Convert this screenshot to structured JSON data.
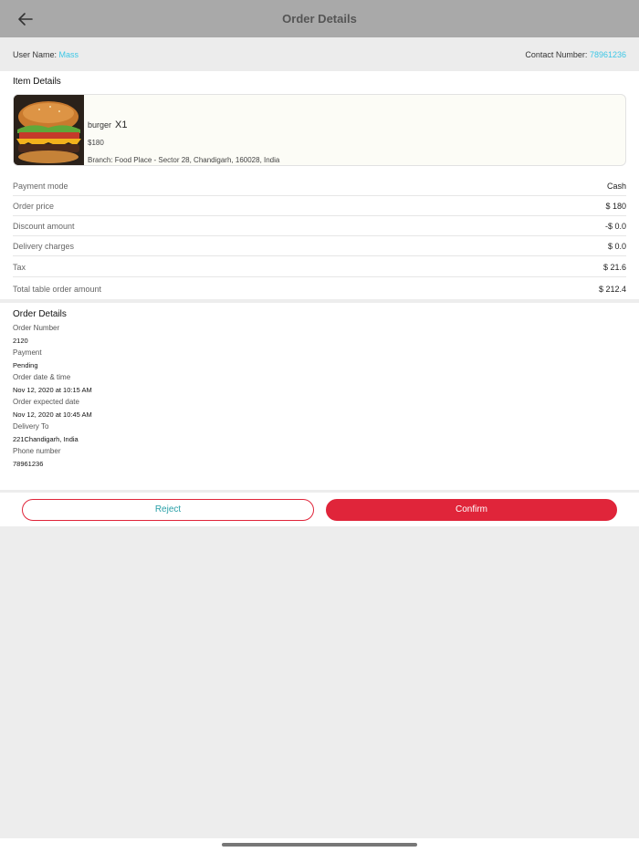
{
  "header": {
    "title": "Order Details"
  },
  "user": {
    "name_label": "User Name:",
    "name": "Mass",
    "contact_label": "Contact Number:",
    "contact": "78961236"
  },
  "item_details": {
    "title": "Item Details",
    "item": {
      "name": "burger",
      "qty": "X1",
      "price": "$180",
      "branch": "Branch: Food Place - Sector 28, Chandigarh, 160028, India"
    }
  },
  "summary": [
    {
      "label": "Payment mode",
      "value": "Cash"
    },
    {
      "label": "Order price",
      "value": "$ 180"
    },
    {
      "label": "Discount amount",
      "value": "-$ 0.0"
    },
    {
      "label": "Delivery charges",
      "value": "$ 0.0"
    },
    {
      "label": "Tax",
      "value": "$ 21.6"
    },
    {
      "label": "Total table order amount",
      "value": "$ 212.4"
    }
  ],
  "order_details": {
    "title": "Order Details",
    "fields": [
      {
        "label": "Order Number",
        "value": "2120"
      },
      {
        "label": "Payment",
        "value": "Pending"
      },
      {
        "label": "Order date & time",
        "value": "Nov 12, 2020 at 10:15 AM"
      },
      {
        "label": "Order expected date",
        "value": "Nov 12, 2020 at 10:45 AM"
      },
      {
        "label": "Delivery To",
        "value": "221Chandigarh, India"
      },
      {
        "label": "Phone number",
        "value": "78961236"
      }
    ]
  },
  "actions": {
    "reject": "Reject",
    "confirm": "Confirm"
  },
  "icons": {
    "back": "arrow-left-icon",
    "item_image": "burger-image"
  },
  "colors": {
    "accent_red": "#e0253a",
    "accent_cyan": "#3cc7e6",
    "header_bg": "#a9a9a9"
  }
}
